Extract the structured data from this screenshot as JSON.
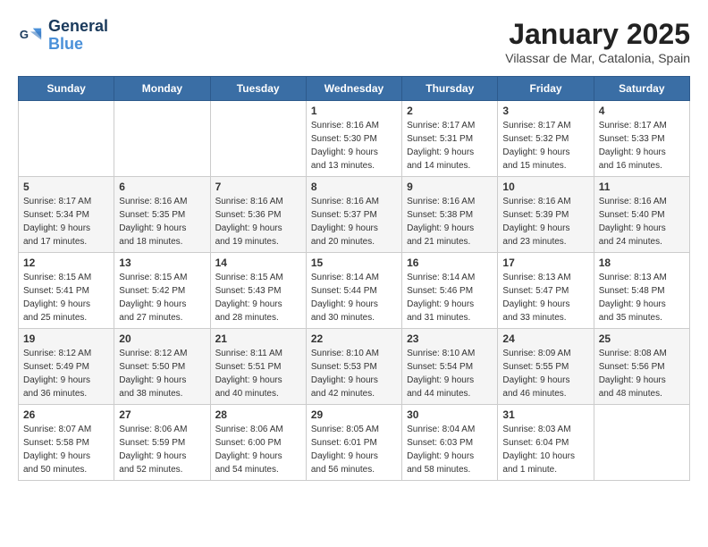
{
  "header": {
    "logo_line1": "General",
    "logo_line2": "Blue",
    "month_year": "January 2025",
    "location": "Vilassar de Mar, Catalonia, Spain"
  },
  "weekdays": [
    "Sunday",
    "Monday",
    "Tuesday",
    "Wednesday",
    "Thursday",
    "Friday",
    "Saturday"
  ],
  "weeks": [
    [
      {
        "day": "",
        "info": ""
      },
      {
        "day": "",
        "info": ""
      },
      {
        "day": "",
        "info": ""
      },
      {
        "day": "1",
        "info": "Sunrise: 8:16 AM\nSunset: 5:30 PM\nDaylight: 9 hours\nand 13 minutes."
      },
      {
        "day": "2",
        "info": "Sunrise: 8:17 AM\nSunset: 5:31 PM\nDaylight: 9 hours\nand 14 minutes."
      },
      {
        "day": "3",
        "info": "Sunrise: 8:17 AM\nSunset: 5:32 PM\nDaylight: 9 hours\nand 15 minutes."
      },
      {
        "day": "4",
        "info": "Sunrise: 8:17 AM\nSunset: 5:33 PM\nDaylight: 9 hours\nand 16 minutes."
      }
    ],
    [
      {
        "day": "5",
        "info": "Sunrise: 8:17 AM\nSunset: 5:34 PM\nDaylight: 9 hours\nand 17 minutes."
      },
      {
        "day": "6",
        "info": "Sunrise: 8:16 AM\nSunset: 5:35 PM\nDaylight: 9 hours\nand 18 minutes."
      },
      {
        "day": "7",
        "info": "Sunrise: 8:16 AM\nSunset: 5:36 PM\nDaylight: 9 hours\nand 19 minutes."
      },
      {
        "day": "8",
        "info": "Sunrise: 8:16 AM\nSunset: 5:37 PM\nDaylight: 9 hours\nand 20 minutes."
      },
      {
        "day": "9",
        "info": "Sunrise: 8:16 AM\nSunset: 5:38 PM\nDaylight: 9 hours\nand 21 minutes."
      },
      {
        "day": "10",
        "info": "Sunrise: 8:16 AM\nSunset: 5:39 PM\nDaylight: 9 hours\nand 23 minutes."
      },
      {
        "day": "11",
        "info": "Sunrise: 8:16 AM\nSunset: 5:40 PM\nDaylight: 9 hours\nand 24 minutes."
      }
    ],
    [
      {
        "day": "12",
        "info": "Sunrise: 8:15 AM\nSunset: 5:41 PM\nDaylight: 9 hours\nand 25 minutes."
      },
      {
        "day": "13",
        "info": "Sunrise: 8:15 AM\nSunset: 5:42 PM\nDaylight: 9 hours\nand 27 minutes."
      },
      {
        "day": "14",
        "info": "Sunrise: 8:15 AM\nSunset: 5:43 PM\nDaylight: 9 hours\nand 28 minutes."
      },
      {
        "day": "15",
        "info": "Sunrise: 8:14 AM\nSunset: 5:44 PM\nDaylight: 9 hours\nand 30 minutes."
      },
      {
        "day": "16",
        "info": "Sunrise: 8:14 AM\nSunset: 5:46 PM\nDaylight: 9 hours\nand 31 minutes."
      },
      {
        "day": "17",
        "info": "Sunrise: 8:13 AM\nSunset: 5:47 PM\nDaylight: 9 hours\nand 33 minutes."
      },
      {
        "day": "18",
        "info": "Sunrise: 8:13 AM\nSunset: 5:48 PM\nDaylight: 9 hours\nand 35 minutes."
      }
    ],
    [
      {
        "day": "19",
        "info": "Sunrise: 8:12 AM\nSunset: 5:49 PM\nDaylight: 9 hours\nand 36 minutes."
      },
      {
        "day": "20",
        "info": "Sunrise: 8:12 AM\nSunset: 5:50 PM\nDaylight: 9 hours\nand 38 minutes."
      },
      {
        "day": "21",
        "info": "Sunrise: 8:11 AM\nSunset: 5:51 PM\nDaylight: 9 hours\nand 40 minutes."
      },
      {
        "day": "22",
        "info": "Sunrise: 8:10 AM\nSunset: 5:53 PM\nDaylight: 9 hours\nand 42 minutes."
      },
      {
        "day": "23",
        "info": "Sunrise: 8:10 AM\nSunset: 5:54 PM\nDaylight: 9 hours\nand 44 minutes."
      },
      {
        "day": "24",
        "info": "Sunrise: 8:09 AM\nSunset: 5:55 PM\nDaylight: 9 hours\nand 46 minutes."
      },
      {
        "day": "25",
        "info": "Sunrise: 8:08 AM\nSunset: 5:56 PM\nDaylight: 9 hours\nand 48 minutes."
      }
    ],
    [
      {
        "day": "26",
        "info": "Sunrise: 8:07 AM\nSunset: 5:58 PM\nDaylight: 9 hours\nand 50 minutes."
      },
      {
        "day": "27",
        "info": "Sunrise: 8:06 AM\nSunset: 5:59 PM\nDaylight: 9 hours\nand 52 minutes."
      },
      {
        "day": "28",
        "info": "Sunrise: 8:06 AM\nSunset: 6:00 PM\nDaylight: 9 hours\nand 54 minutes."
      },
      {
        "day": "29",
        "info": "Sunrise: 8:05 AM\nSunset: 6:01 PM\nDaylight: 9 hours\nand 56 minutes."
      },
      {
        "day": "30",
        "info": "Sunrise: 8:04 AM\nSunset: 6:03 PM\nDaylight: 9 hours\nand 58 minutes."
      },
      {
        "day": "31",
        "info": "Sunrise: 8:03 AM\nSunset: 6:04 PM\nDaylight: 10 hours\nand 1 minute."
      },
      {
        "day": "",
        "info": ""
      }
    ]
  ]
}
